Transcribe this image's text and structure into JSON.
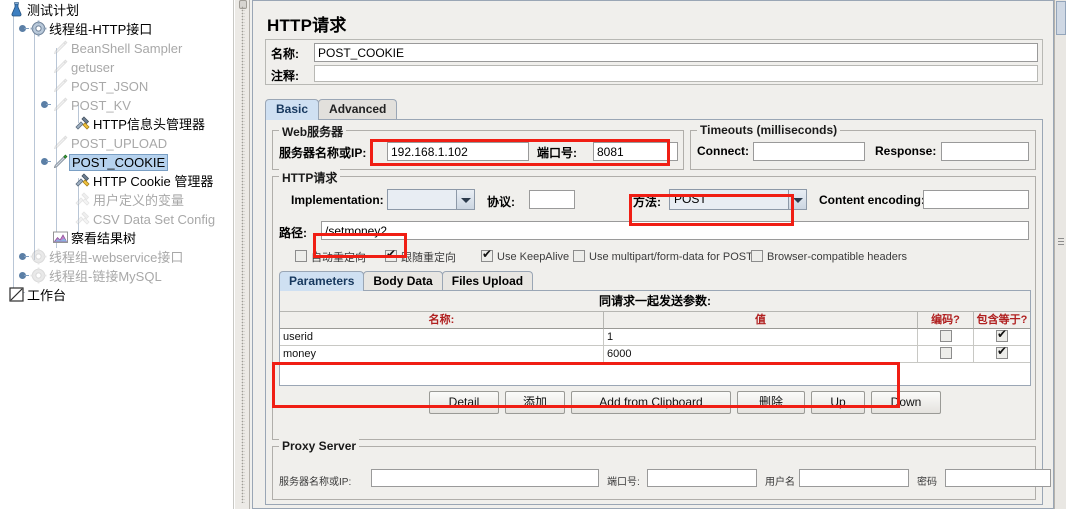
{
  "tree": {
    "nodes": [
      {
        "label": "测试计划",
        "icon": "test-plan-icon",
        "depth": 0,
        "state": "normal",
        "handle": false
      },
      {
        "label": "线程组-HTTP接口",
        "icon": "thread-group-icon",
        "depth": 1,
        "state": "normal",
        "handle": true
      },
      {
        "label": "BeanShell Sampler",
        "icon": "sampler-disabled-icon",
        "depth": 2,
        "state": "disabled",
        "handle": false
      },
      {
        "label": "getuser",
        "icon": "sampler-disabled-icon",
        "depth": 2,
        "state": "disabled",
        "handle": false
      },
      {
        "label": "POST_JSON",
        "icon": "sampler-disabled-icon",
        "depth": 2,
        "state": "disabled",
        "handle": false
      },
      {
        "label": "POST_KV",
        "icon": "sampler-disabled-icon",
        "depth": 2,
        "state": "disabled",
        "handle": true
      },
      {
        "label": "HTTP信息头管理器",
        "icon": "header-manager-icon",
        "depth": 3,
        "state": "normal",
        "handle": false
      },
      {
        "label": "POST_UPLOAD",
        "icon": "sampler-disabled-icon",
        "depth": 2,
        "state": "disabled",
        "handle": false
      },
      {
        "label": "POST_COOKIE",
        "icon": "sampler-icon",
        "depth": 2,
        "state": "selected",
        "handle": true
      },
      {
        "label": "HTTP Cookie 管理器",
        "icon": "cookie-manager-icon",
        "depth": 3,
        "state": "normal",
        "handle": false
      },
      {
        "label": "用户定义的变量",
        "icon": "config-disabled-icon",
        "depth": 3,
        "state": "disabled",
        "handle": false
      },
      {
        "label": "CSV Data Set Config",
        "icon": "config-disabled-icon",
        "depth": 3,
        "state": "disabled",
        "handle": false
      },
      {
        "label": "察看结果树",
        "icon": "view-results-tree-icon",
        "depth": 2,
        "state": "normal",
        "handle": false
      },
      {
        "label": "线程组-webservice接口",
        "icon": "thread-group-disabled-icon",
        "depth": 1,
        "state": "disabled",
        "handle": true
      },
      {
        "label": "线程组-链接MySQL",
        "icon": "thread-group-disabled-icon",
        "depth": 1,
        "state": "disabled",
        "handle": true
      },
      {
        "label": "工作台",
        "icon": "workbench-icon",
        "depth": 0,
        "state": "normal",
        "handle": false
      }
    ]
  },
  "panel": {
    "title": "HTTP请求",
    "name_label": "名称:",
    "name_value": "POST_COOKIE",
    "comment_label": "注释:",
    "comment_value": "",
    "tabs": [
      {
        "label": "Basic",
        "active": true
      },
      {
        "label": "Advanced",
        "active": false
      }
    ]
  },
  "web_server": {
    "group_title": "Web服务器",
    "server_label": "服务器名称或IP:",
    "server_value": "192.168.1.102",
    "port_label": "端口号:",
    "port_value": "8081"
  },
  "timeouts": {
    "group_title": "Timeouts (milliseconds)",
    "connect_label": "Connect:",
    "connect_value": "",
    "response_label": "Response:",
    "response_value": ""
  },
  "http_request": {
    "group_title": "HTTP请求",
    "implementation_label": "Implementation:",
    "implementation_value": "",
    "protocol_label": "协议:",
    "protocol_value": "",
    "method_label": "方法:",
    "method_value": "POST",
    "content_encoding_label": "Content encoding:",
    "content_encoding_value": "",
    "path_label": "路径:",
    "path_value": "/setmoney2",
    "checkboxes": [
      {
        "label": "自动重定向",
        "checked": false
      },
      {
        "label": "跟随重定向",
        "checked": true
      },
      {
        "label": "Use KeepAlive",
        "checked": true
      },
      {
        "label": "Use multipart/form-data for POST",
        "checked": false
      },
      {
        "label": "Browser-compatible headers",
        "checked": false
      }
    ]
  },
  "params_section": {
    "tabs": [
      {
        "label": "Parameters",
        "active": true
      },
      {
        "label": "Body Data",
        "active": false
      },
      {
        "label": "Files Upload",
        "active": false
      }
    ],
    "caption": "同请求一起发送参数:",
    "columns": [
      "名称:",
      "值",
      "编码?",
      "包含等于?"
    ],
    "rows": [
      {
        "name": "userid",
        "value": "1",
        "encode": false,
        "include_equals": true
      },
      {
        "name": "money",
        "value": "6000",
        "encode": false,
        "include_equals": true
      }
    ],
    "buttons": [
      "Detail",
      "添加",
      "Add from Clipboard",
      "删除",
      "Up",
      "Down"
    ]
  },
  "proxy_server": {
    "group_title": "Proxy Server",
    "server_label": "服务器名称或IP:",
    "server_value": "",
    "port_label": "端口号:",
    "port_value": "",
    "user_label": "用户名",
    "user_value": "",
    "password_label": "密码",
    "password_value": ""
  },
  "colors": {
    "annotation_red": "#f01e14",
    "tab_active": "#cfe0f2",
    "selection_blue": "#b6d2ee",
    "header_red_text": "#b02020"
  }
}
